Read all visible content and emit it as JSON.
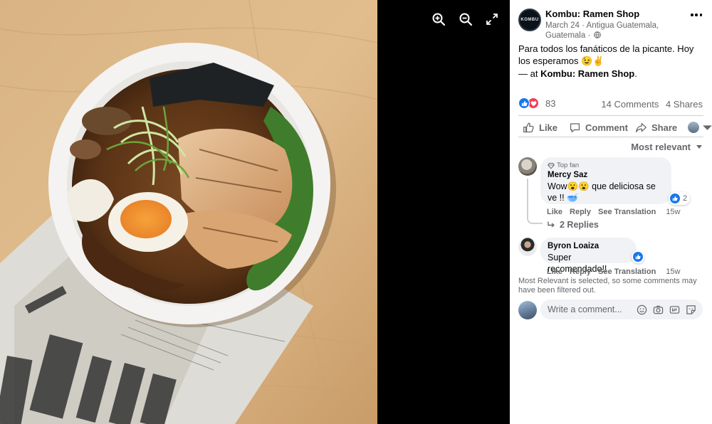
{
  "viewer": {
    "tools": [
      {
        "name": "zoom-in",
        "icon": "zoom-in-icon"
      },
      {
        "name": "zoom-out",
        "icon": "zoom-out-icon"
      },
      {
        "name": "fullscreen",
        "icon": "expand-icon"
      }
    ]
  },
  "post": {
    "page_name": "Kombu: Ramen Shop",
    "avatar_text": "KOMBU",
    "meta": "March 24 · Antigua Guatemala, Guatemala ·",
    "text": "Para todos los fanáticos de la picante. Hoy los esperamos 😉✌️",
    "at_prefix": "— at ",
    "at_place": "Kombu: Ramen Shop",
    "at_suffix": ".",
    "reactions_count": "83",
    "comments_count": "14 Comments",
    "shares_count": "4 Shares"
  },
  "actions": {
    "like": "Like",
    "comment": "Comment",
    "share": "Share"
  },
  "sort_label": "Most relevant",
  "comments": [
    {
      "badge": "Top fan",
      "author": "Mercy Saz",
      "text": "Wow😮😮 que deliciosa se ve !! 🥣",
      "reaction_count": "2",
      "like": "Like",
      "reply": "Reply",
      "translate": "See Translation",
      "time": "15w",
      "replies_label": "2 Replies"
    },
    {
      "author": "Byron Loaiza",
      "text": "Super recomendado!!",
      "like": "Like",
      "reply": "Reply",
      "translate": "See Translation",
      "time": "15w"
    }
  ],
  "filter_note": "Most Relevant is selected, so some comments may have been filtered out.",
  "composer": {
    "placeholder": "Write a comment...",
    "icons": [
      "emoji-icon",
      "camera-icon",
      "gif-icon",
      "sticker-icon"
    ]
  },
  "colors": {
    "accent": "#1877f2",
    "love": "#f33e58",
    "secondary_text": "#65676b",
    "bubble": "#f0f2f5"
  }
}
